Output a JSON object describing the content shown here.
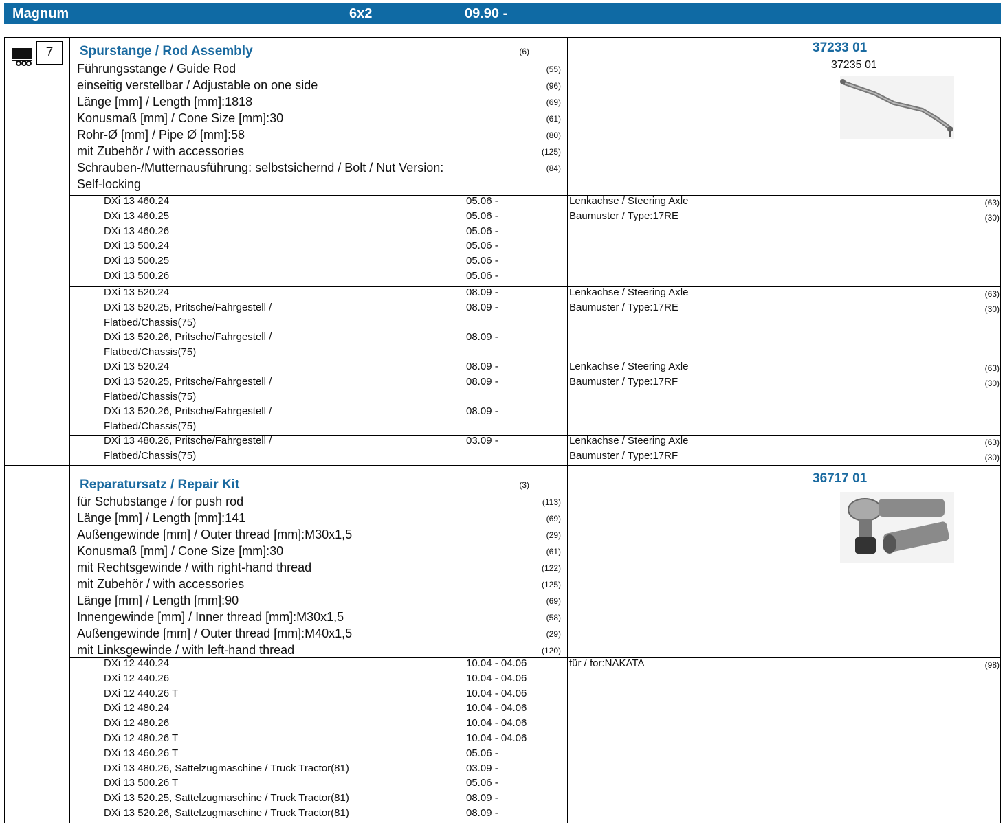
{
  "header": {
    "model": "Magnum",
    "axle": "6x2",
    "date": "09.90 -"
  },
  "section1": {
    "badge": "7",
    "title": "Spurstange / Rod Assembly",
    "title_code": "(6)",
    "attributes": [
      {
        "text": "Führungsstange / Guide Rod",
        "code": "(55)"
      },
      {
        "text": "einseitig verstellbar / Adjustable on one side",
        "code": "(96)"
      },
      {
        "text": "Länge [mm] / Length [mm]:1818",
        "code": "(69)"
      },
      {
        "text": "Konusmaß [mm] / Cone Size [mm]:30",
        "code": "(61)"
      },
      {
        "text": "Rohr-Ø [mm] / Pipe Ø [mm]:58",
        "code": "(80)"
      },
      {
        "text": "mit Zubehör / with accessories",
        "code": "(125)"
      },
      {
        "text": "Schrauben-/Mutternausführung: selbstsichernd / Bolt / Nut Version:",
        "code": "(84)"
      },
      {
        "text": "Self-locking",
        "code": ""
      }
    ],
    "part_number": "37233 01",
    "alt_part_number": "37235 01",
    "groups": [
      {
        "models": [
          [
            "DXi 13 460.24",
            "05.06 -"
          ],
          [
            "DXi 13 460.25",
            "05.06 -"
          ],
          [
            "DXi 13 460.26",
            "05.06 -"
          ],
          [
            "DXi 13 500.24",
            "05.06 -"
          ],
          [
            "DXi 13 500.25",
            "05.06 -"
          ],
          [
            "DXi 13 500.26",
            "05.06 -"
          ]
        ],
        "notes": [
          [
            "Lenkachse / Steering Axle",
            "(63)"
          ],
          [
            "Baumuster / Type:17RE",
            "(30)"
          ]
        ]
      },
      {
        "models": [
          [
            "DXi 13 520.24",
            "08.09 -"
          ],
          [
            "DXi 13 520.25, Pritsche/Fahrgestell /",
            "08.09 -"
          ],
          [
            "Flatbed/Chassis(75)",
            ""
          ],
          [
            "DXi 13 520.26, Pritsche/Fahrgestell /",
            "08.09 -"
          ],
          [
            "Flatbed/Chassis(75)",
            ""
          ]
        ],
        "notes": [
          [
            "Lenkachse / Steering Axle",
            "(63)"
          ],
          [
            "Baumuster / Type:17RE",
            "(30)"
          ]
        ]
      },
      {
        "models": [
          [
            "DXi 13 520.24",
            "08.09 -"
          ],
          [
            "DXi 13 520.25, Pritsche/Fahrgestell /",
            "08.09 -"
          ],
          [
            "Flatbed/Chassis(75)",
            ""
          ],
          [
            "DXi 13 520.26, Pritsche/Fahrgestell /",
            "08.09 -"
          ],
          [
            "Flatbed/Chassis(75)",
            ""
          ]
        ],
        "notes": [
          [
            "Lenkachse / Steering Axle",
            "(63)"
          ],
          [
            "Baumuster / Type:17RF",
            "(30)"
          ]
        ]
      },
      {
        "models": [
          [
            "DXi 13 480.26, Pritsche/Fahrgestell /",
            "03.09 -"
          ],
          [
            "Flatbed/Chassis(75)",
            ""
          ]
        ],
        "notes": [
          [
            "Lenkachse / Steering Axle",
            "(63)"
          ],
          [
            "Baumuster / Type:17RF",
            "(30)"
          ]
        ]
      }
    ]
  },
  "section2": {
    "title": "Reparatursatz / Repair Kit",
    "title_code": "(3)",
    "attributes": [
      {
        "text": "für Schubstange / for push rod",
        "code": "(113)"
      },
      {
        "text": "Länge [mm] / Length [mm]:141",
        "code": "(69)"
      },
      {
        "text": "Außengewinde [mm] / Outer thread [mm]:M30x1,5",
        "code": "(29)"
      },
      {
        "text": "Konusmaß [mm] / Cone Size [mm]:30",
        "code": "(61)"
      },
      {
        "text": "mit Rechtsgewinde / with right-hand thread",
        "code": "(122)"
      },
      {
        "text": "mit Zubehör / with accessories",
        "code": "(125)"
      },
      {
        "text": "Länge [mm] / Length [mm]:90",
        "code": "(69)"
      },
      {
        "text": "Innengewinde [mm] / Inner thread [mm]:M30x1,5",
        "code": "(58)"
      },
      {
        "text": "Außengewinde [mm] / Outer thread [mm]:M40x1,5",
        "code": "(29)"
      },
      {
        "text": "mit Linksgewinde / with left-hand thread",
        "code": "(120)"
      }
    ],
    "part_number": "36717 01",
    "models": [
      [
        "DXi 12 440.24",
        "10.04 - 04.06"
      ],
      [
        "DXi 12 440.26",
        "10.04 - 04.06"
      ],
      [
        "DXi 12 440.26 T",
        "10.04 - 04.06"
      ],
      [
        "DXi 12 480.24",
        "10.04 - 04.06"
      ],
      [
        "DXi 12 480.26",
        "10.04 - 04.06"
      ],
      [
        "DXi 12 480.26 T",
        "10.04 - 04.06"
      ],
      [
        "DXi 13 460.26 T",
        "05.06 -"
      ],
      [
        "DXi 13 480.26, Sattelzugmaschine / Truck Tractor(81)",
        "03.09 -"
      ],
      [
        "DXi 13 500.26 T",
        "05.06 -"
      ],
      [
        "DXi 13 520.25, Sattelzugmaschine / Truck Tractor(81)",
        "08.09 -"
      ],
      [
        "DXi 13 520.26, Sattelzugmaschine / Truck Tractor(81)",
        "08.09 -"
      ]
    ],
    "notes": [
      [
        "für / for:NAKATA",
        "(98)"
      ]
    ]
  }
}
